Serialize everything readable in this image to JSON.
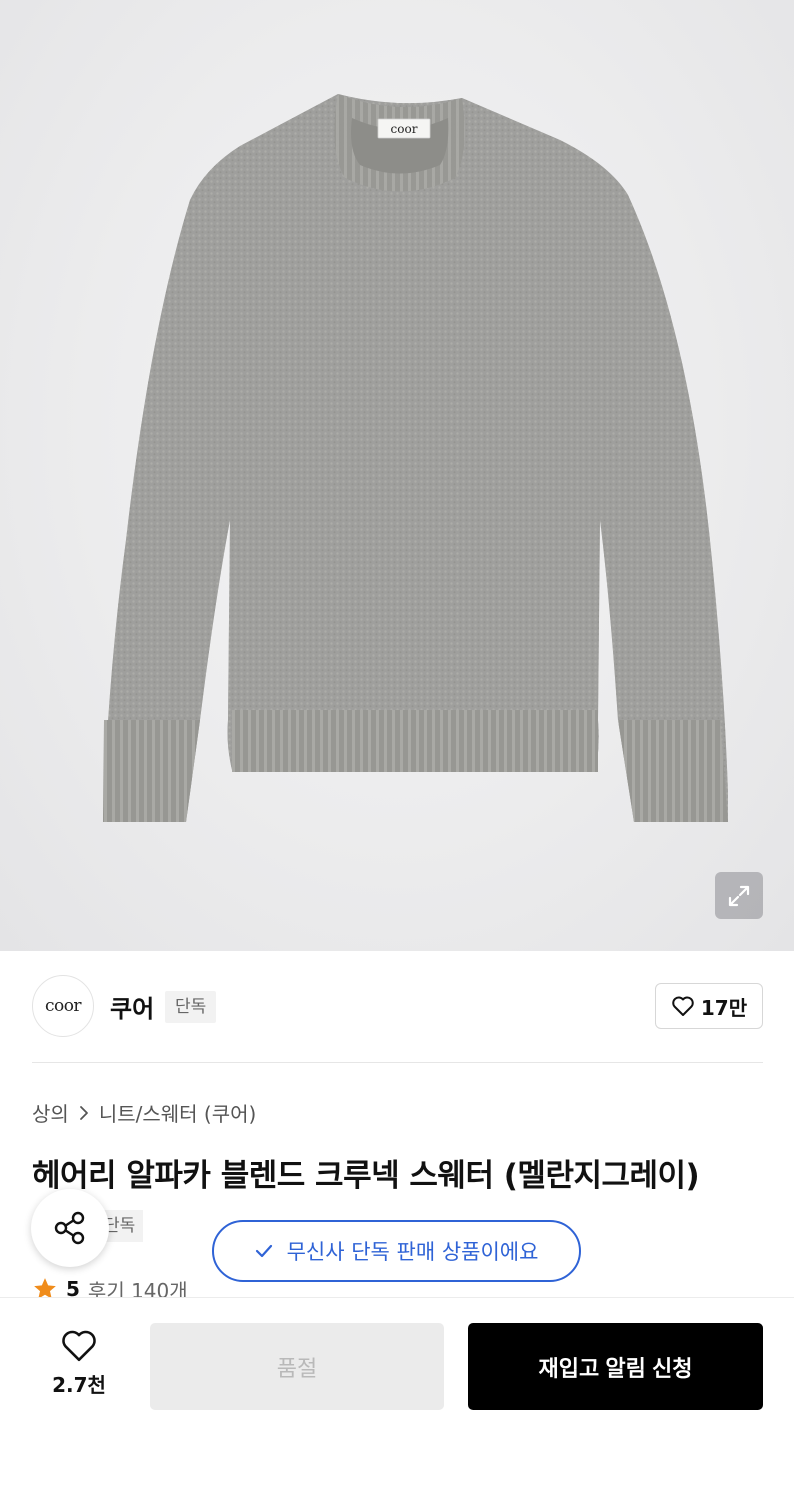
{
  "product_image": {
    "garment_label": "coor",
    "zoom_icon": "expand-arrows-icon"
  },
  "brand": {
    "logo_text": "coor",
    "name": "쿠어",
    "badge": "단독",
    "likes": "17만"
  },
  "breadcrumb": {
    "category": "상의",
    "subcategory": "니트/스웨터 (쿠어)"
  },
  "product": {
    "title": "헤어리 알파카 블렌드 크루넥 스웨터 (멜란지그레이)",
    "tag": "단독"
  },
  "toast": {
    "message": "무신사 단독 판매 상품이에요"
  },
  "rating": {
    "score": "5",
    "reviews": "후기 140개"
  },
  "bottom_bar": {
    "wish_count": "2.7천",
    "soldout_label": "품절",
    "restock_label": "재입고 알림 신청"
  },
  "colors": {
    "toast_accent": "#2f63d6",
    "star": "#f08c1b",
    "primary_button": "#000000"
  }
}
